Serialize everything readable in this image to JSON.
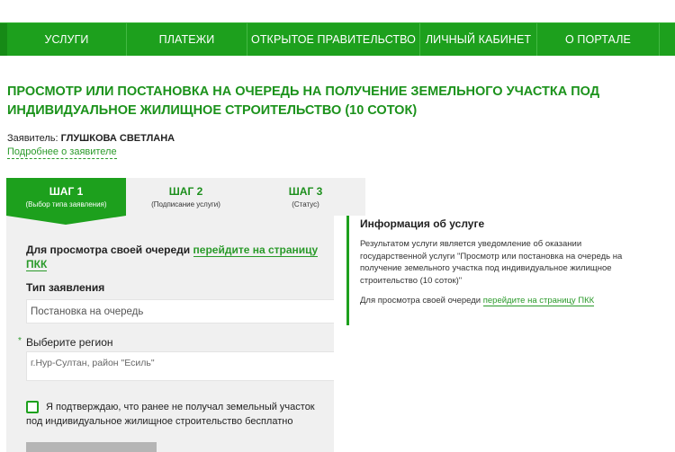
{
  "nav": {
    "items": [
      {
        "label": "УСЛУГИ"
      },
      {
        "label": "ПЛАТЕЖИ"
      },
      {
        "label": "ОТКРЫТОЕ ПРАВИТЕЛЬСТВО"
      },
      {
        "label": "ЛИЧНЫЙ КАБИНЕТ"
      },
      {
        "label": "О ПОРТАЛЕ"
      }
    ]
  },
  "page": {
    "title": "ПРОСМОТР ИЛИ ПОСТАНОВКА НА ОЧЕРЕДЬ НА ПОЛУЧЕНИЕ ЗЕМЕЛЬНОГО УЧАСТКА ПОД ИНДИВИДУАЛЬНОЕ ЖИЛИЩНОЕ СТРОИТЕЛЬСТВО (10 СОТОК)",
    "applicant_label": "Заявитель:",
    "applicant_name": "ГЛУШКОВА СВЕТЛАНА",
    "more_link": "Подробнее о заявителе"
  },
  "steps": [
    {
      "title": "ШАГ 1",
      "sub": "(Выбор типа заявления)",
      "active": true
    },
    {
      "title": "ШАГ 2",
      "sub": "(Подписание услуги)",
      "active": false
    },
    {
      "title": "ШАГ 3",
      "sub": "(Статус)",
      "active": false
    }
  ],
  "form": {
    "pkk_text": "Для просмотра своей очереди",
    "pkk_link": "перейдите на страницу ПКК",
    "type_label": "Тип заявления",
    "type_value": "Постановка на очередь",
    "required_mark": "*",
    "region_label": "Выберите регион",
    "region_placeholder": "г.Нур-Султан, район \"Есиль\"",
    "confirm_text": "Я подтверждаю, что ранее не получал земельный участок под индивидуальное жилищное строительство бесплатно"
  },
  "info": {
    "title": "Информация об услуге",
    "text": "Результатом услуги является уведомление об оказании государственной услуги \"Просмотр или постановка на очередь на получение земельного участка под индивидуальное жилищное строительство (10 соток)\"",
    "pkk_text": "Для просмотра своей очереди",
    "pkk_link": "перейдите на страницу ПКК"
  },
  "colors": {
    "brand_green": "#1da01d",
    "link_green": "#2a9a2a",
    "panel_gray": "#f0f0f0"
  }
}
